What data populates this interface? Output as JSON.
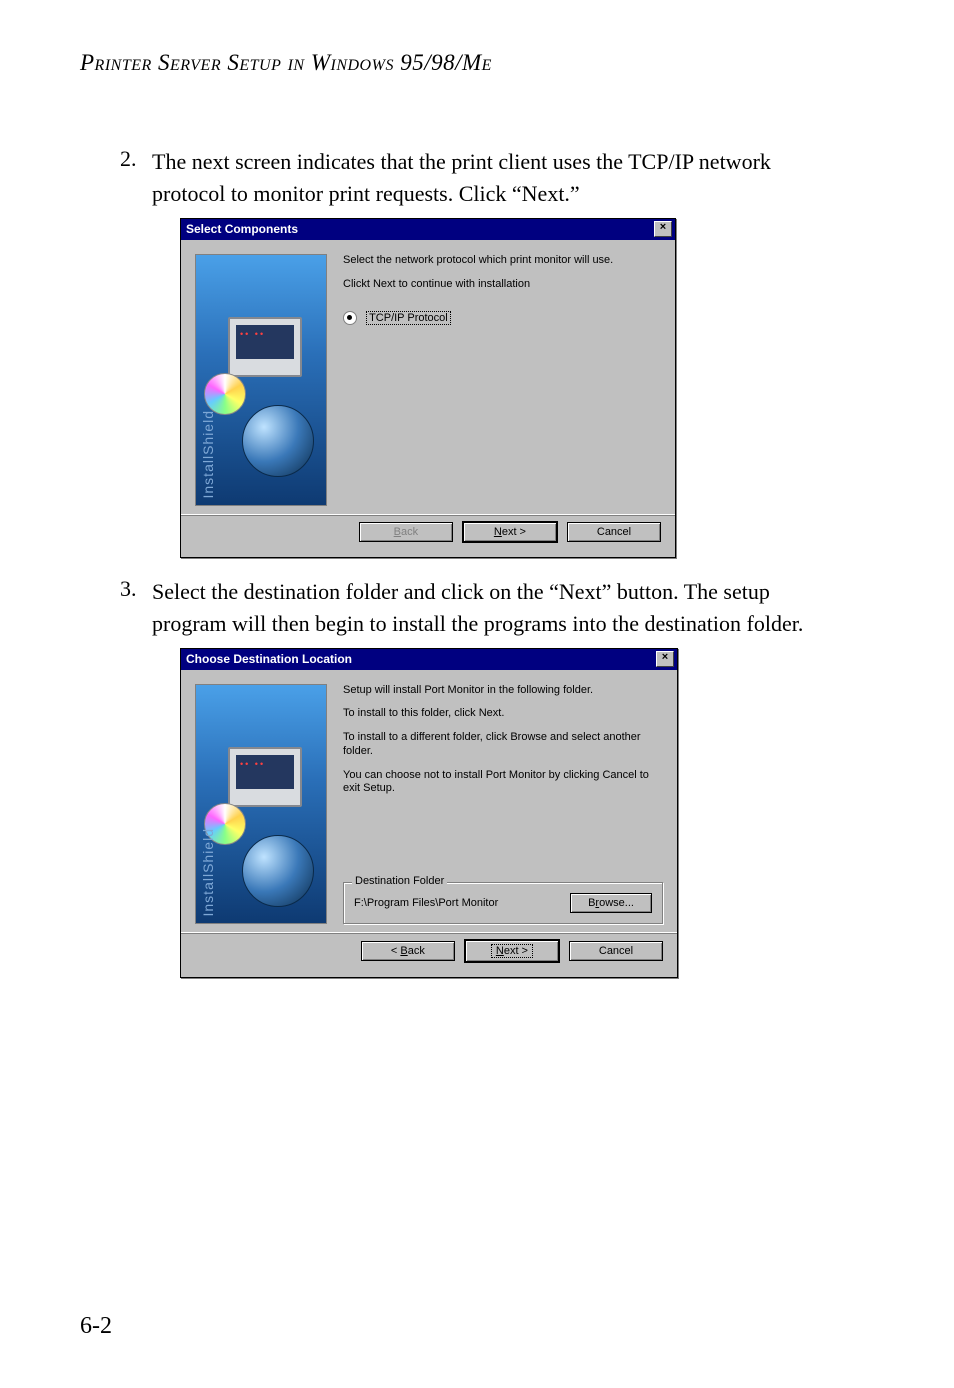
{
  "header": {
    "title": "Printer Server Setup in Windows 95/98/Me"
  },
  "steps": [
    {
      "num": "2.",
      "text": "The next screen indicates that the print client uses the TCP/IP network protocol to monitor print requests. Click “Next.”"
    },
    {
      "num": "3.",
      "text": "Select the destination folder and click on the “Next” button. The setup program will then begin to install the programs into the destination folder."
    }
  ],
  "dialog1": {
    "title": "Select Components",
    "close": "×",
    "line1": "Select the network protocol which print monitor will use.",
    "line2": "Clickt Next to continue with installation",
    "radio_label": "TCP/IP  Protocol",
    "sidebar_text": "InstallShield",
    "back": "< Back",
    "next": "Next >",
    "cancel": "Cancel"
  },
  "dialog2": {
    "title": "Choose Destination Location",
    "close": "×",
    "p1": "Setup will install Port Monitor in the following folder.",
    "p2": "To install to this folder, click Next.",
    "p3": "To install to a different folder, click Browse and select another folder.",
    "p4": "You can choose not to install Port Monitor by clicking Cancel to exit Setup.",
    "group_legend": "Destination Folder",
    "path": "F:\\Program Files\\Port Monitor",
    "browse": "Browse...",
    "sidebar_text": "InstallShield",
    "back": "< Back",
    "next": "Next >",
    "cancel": "Cancel"
  },
  "page_number": "6-2"
}
